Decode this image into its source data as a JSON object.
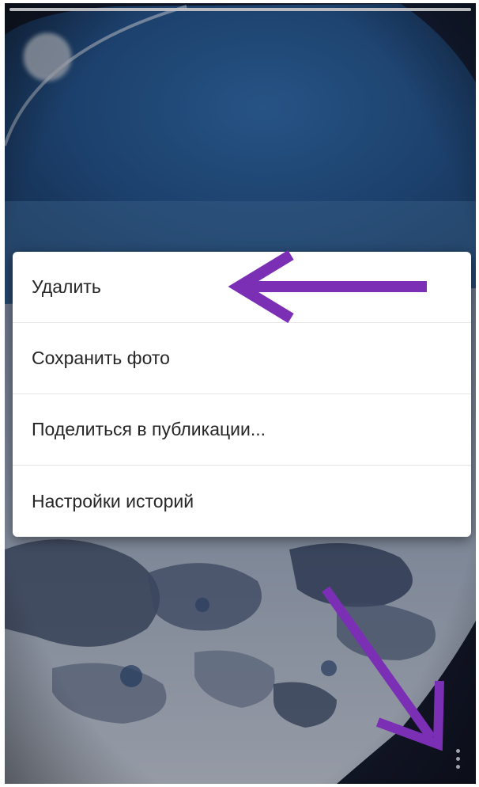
{
  "story": {
    "author_name": "",
    "progress": 1.0
  },
  "menu": {
    "items": [
      {
        "label": "Удалить"
      },
      {
        "label": "Сохранить фото"
      },
      {
        "label": "Поделиться в публикации..."
      },
      {
        "label": "Настройки историй"
      }
    ]
  },
  "icons": {
    "more": "more-vertical-icon"
  },
  "colors": {
    "annotation_arrow": "#7b2fb5",
    "menu_background": "#ffffff",
    "menu_text": "#262626"
  }
}
